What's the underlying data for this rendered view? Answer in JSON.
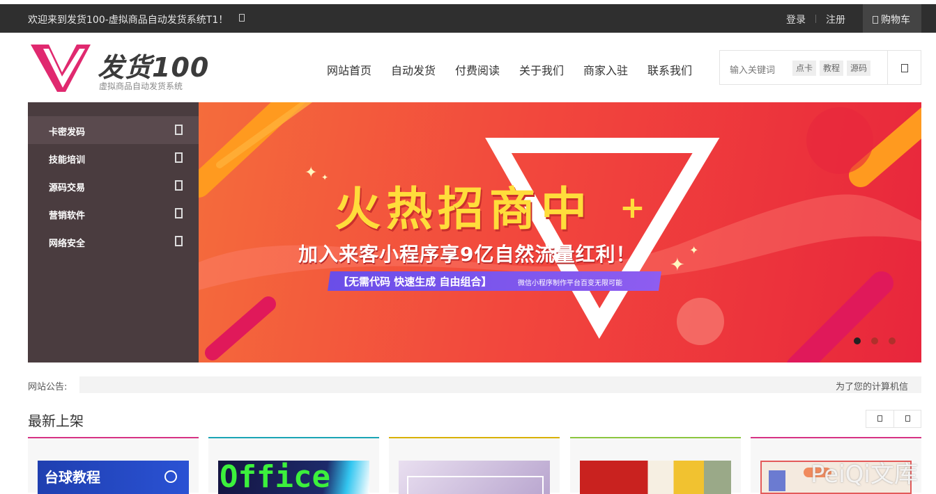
{
  "topbar": {
    "welcome": "欢迎来到发货100-虚拟商品自动发货系统T1！",
    "login": "登录",
    "register": "注册",
    "cart": "购物车"
  },
  "logo": {
    "wordmark": "发货100",
    "tagline": "虚拟商品自动发货系统"
  },
  "nav": [
    "网站首页",
    "自动发货",
    "付费阅读",
    "关于我们",
    "商家入驻",
    "联系我们"
  ],
  "search": {
    "placeholder": "输入关键词",
    "tags": [
      "点卡",
      "教程",
      "源码"
    ]
  },
  "sidebar": {
    "items": [
      "卡密发码",
      "技能培训",
      "源码交易",
      "营销软件",
      "网络安全"
    ]
  },
  "banner": {
    "headline": "火热招商中",
    "plus": "+",
    "subline": "加入来客小程序享9亿自然流量红利！",
    "pill_left": "【无需代码  快速生成  自由组合】",
    "pill_right": "微信小程序制作平台百变无限可能",
    "active_slide": 1,
    "slide_count": 3
  },
  "notice": {
    "label": "网站公告:",
    "text": "为了您的计算机信"
  },
  "section": {
    "title": "最新上架"
  },
  "cards": [
    {
      "accent": "#d63384",
      "thumb_bg": "#1f3fb0",
      "thumb_text": "台球教程",
      "text_color": "#ffffff"
    },
    {
      "accent": "#1aa5b5",
      "thumb_bg": "#1a1a4a",
      "thumb_text": "Office",
      "text_color": "#3cf03c"
    },
    {
      "accent": "#d9b100",
      "thumb_bg": "#c9b7d9",
      "thumb_text": "",
      "text_color": "#ffffff"
    },
    {
      "accent": "#8cc63f",
      "thumb_bg": "#c9221f",
      "thumb_text": "",
      "text_color": "#ffffff"
    },
    {
      "accent": "#d63384",
      "thumb_bg": "#f4eadf",
      "thumb_text": "",
      "text_color": "#ffffff"
    }
  ],
  "watermark": "PeiQi文库",
  "colors": {
    "topbar": "#2f2f2f",
    "sidebar": "#4a3c3f",
    "logo_pink": "#e0296f",
    "banner_red": "#f2473d",
    "headline_yellow": "#ffdd3b"
  }
}
